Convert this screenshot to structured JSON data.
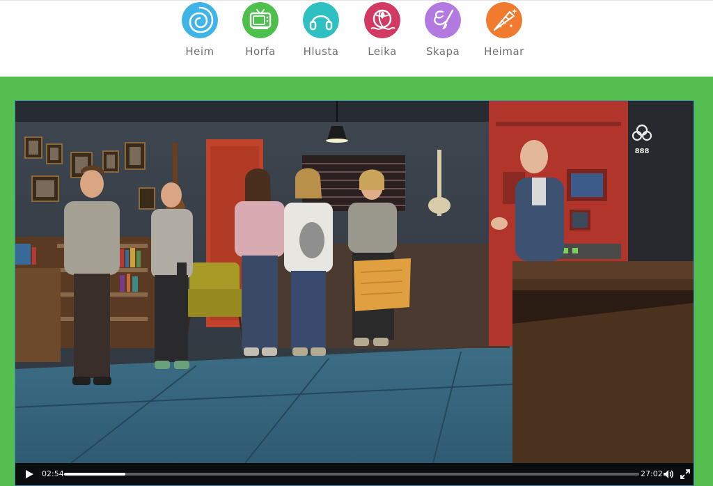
{
  "nav": {
    "items": [
      {
        "label": "Heim",
        "icon": "spiral-icon",
        "color": "#3fb4e6"
      },
      {
        "label": "Horfa",
        "icon": "tv-icon",
        "color": "#4cc04a"
      },
      {
        "label": "Hlusta",
        "icon": "headphones-icon",
        "color": "#2fc1c1"
      },
      {
        "label": "Leika",
        "icon": "beach-ball-icon",
        "color": "#d23a63"
      },
      {
        "label": "Skapa",
        "icon": "paintbrush-icon",
        "color": "#b27ae0"
      },
      {
        "label": "Heimar",
        "icon": "unicorn-horn-icon",
        "color": "#f07a2e"
      }
    ]
  },
  "stage": {
    "background_color": "#54bf4f"
  },
  "player": {
    "elapsed": "02:54",
    "duration": "27:02",
    "progress_fraction": 0.107,
    "channel_logo": "888-logo-icon",
    "channel_logo_text": "888"
  }
}
